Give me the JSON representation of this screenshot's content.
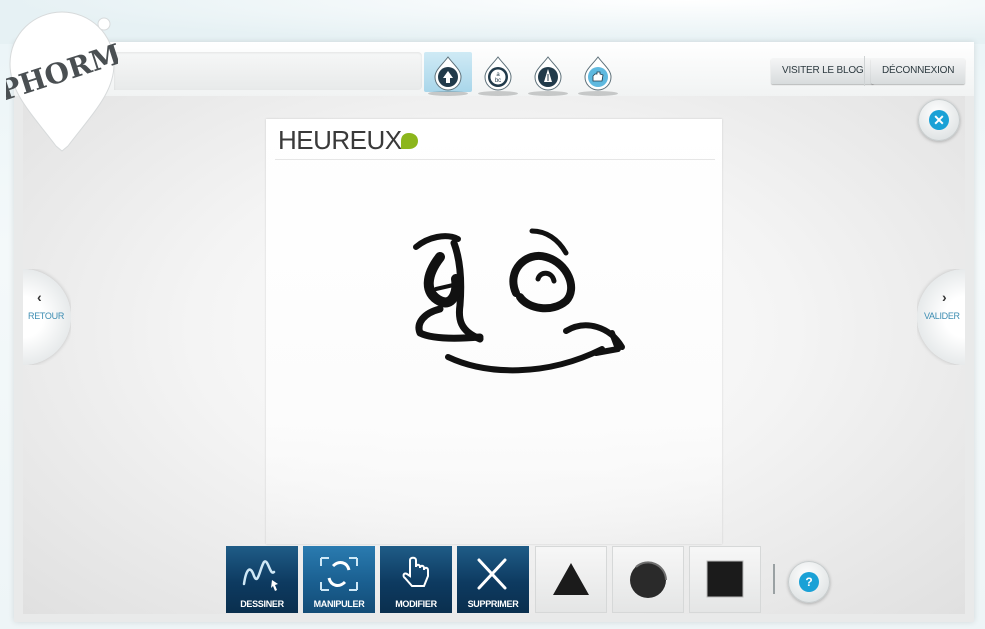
{
  "app": {
    "logo_text": "PHORM"
  },
  "header": {
    "mode_tabs": [
      {
        "icon": "tree-drop-icon",
        "active": true
      },
      {
        "icon": "abc-drop-icon",
        "active": false
      },
      {
        "icon": "pen-tip-drop-icon",
        "active": false
      },
      {
        "icon": "hand-drop-icon",
        "active": false
      }
    ],
    "visit_blog_label": "VISITER LE BLOG",
    "logout_label": "DÉCONNEXION"
  },
  "navigation": {
    "back_label": "RETOUR",
    "back_arrow": "‹",
    "validate_label": "VALIDER",
    "validate_arrow": "›"
  },
  "card": {
    "title": "HEUREUX",
    "bubble_color": "#8cb61c",
    "drawing_icon": "happy-face-sketch"
  },
  "toolbar": {
    "tools": [
      {
        "label": "DESSINER",
        "icon": "draw-hand-icon"
      },
      {
        "label": "MANIPULER",
        "icon": "manipulate-arrows-icon"
      },
      {
        "label": "MODIFIER",
        "icon": "modify-hand-icon"
      },
      {
        "label": "SUPPRIMER",
        "icon": "delete-x-icon"
      }
    ],
    "shapes": [
      {
        "name": "triangle-shape-icon"
      },
      {
        "name": "circle-shape-icon"
      },
      {
        "name": "square-shape-icon"
      }
    ]
  },
  "help": {
    "label": "?"
  },
  "close": {
    "label": "✕"
  },
  "colors": {
    "accent": "#1aa1d6",
    "tool_bg": "#0d3a60"
  }
}
